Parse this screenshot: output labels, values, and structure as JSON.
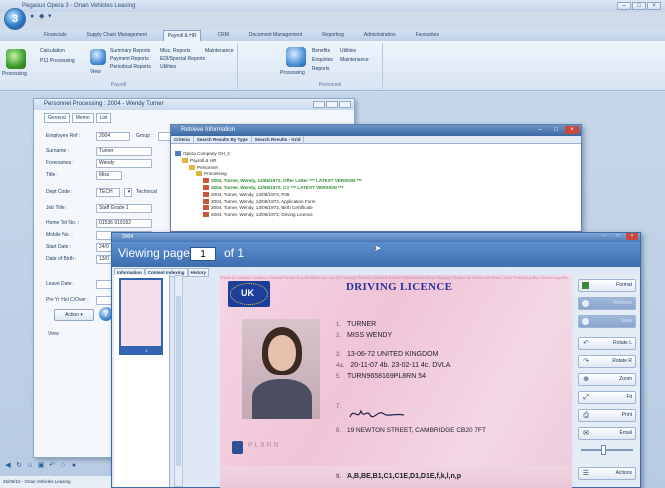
{
  "app": {
    "title": "Pegasus Opera 3 - Onan Vehicles Leasing",
    "window_controls": [
      "–",
      "□",
      "×"
    ]
  },
  "ribbon": {
    "tabs": [
      "Financials",
      "Supply Chain Management",
      "Payroll & HR",
      "CRM",
      "Document Management",
      "Reporting",
      "Administration",
      "Favourites"
    ],
    "active_tab": "Payroll & HR",
    "group_payroll": {
      "label": "Payroll",
      "processing": "Processing",
      "calculation": "Calculation",
      "p11_processing": "P11 Processing",
      "view": "View",
      "summary_reports": "Summary Reports",
      "payment_reports": "Payment Reports",
      "periodical_reports": "Periodical Reports",
      "misc_reports": "Misc. Reports",
      "edi_special_reports": "EDI/Special Reports",
      "utilities": "Utilities",
      "maintenance": "Maintenance"
    },
    "group_personnel": {
      "label": "Personnel",
      "processing": "Processing",
      "benefits": "Benefits",
      "enquiries": "Enquiries",
      "reports": "Reports",
      "utilities": "Utilities",
      "maintenance": "Maintenance"
    }
  },
  "personnel": {
    "title": "Personnel Processing : 2004 - Wendy Turner",
    "tabs": [
      "General",
      "Memo",
      "List"
    ],
    "fields": [
      {
        "label": "Employee Ref :",
        "value": "2004"
      },
      {
        "label": "Surname :",
        "value": "Turner"
      },
      {
        "label": "Forenames :",
        "value": "Wendy"
      },
      {
        "label": "Title :",
        "value": "Miss"
      },
      {
        "label": "Dept Code :",
        "value": "TECH"
      },
      {
        "label": "Job Title :",
        "value": "Staff Grade 1"
      },
      {
        "label": "Home Tel No. :",
        "value": "01536 919192"
      },
      {
        "label": "Mobile No. :",
        "value": ""
      },
      {
        "label": "Start Date :",
        "value": "24/0"
      },
      {
        "label": "Date of Birth :",
        "value": "13/0"
      },
      {
        "label": "Leave Date :",
        "value": ""
      },
      {
        "label": "Prv Yr Hol C/Over :",
        "value": ""
      }
    ],
    "group_label": "Group :",
    "dept_desc": "Technical",
    "action_btn": "Action",
    "help": "?",
    "view_label": "View"
  },
  "retrieve": {
    "title": "Retrieve Information",
    "tabs": [
      "Criteria",
      "Search Results By Type",
      "Search Results - Grid"
    ],
    "tree": [
      {
        "label": "Opera Company OH_2",
        "level": 0,
        "hl": false
      },
      {
        "label": "Payroll & HR",
        "level": 1,
        "hl": false
      },
      {
        "label": "Personnel",
        "level": 2,
        "hl": false
      },
      {
        "label": "Processing",
        "level": 3,
        "hl": false
      },
      {
        "label": "2004, Turner, Wendy, 13/06/1972, Offer Letter *** LATEST VERSION ***",
        "level": 4,
        "hl": true
      },
      {
        "label": "2004, Turner, Wendy, 13/06/1972, CV *** LATEST VERSION ***",
        "level": 4,
        "hl": true
      },
      {
        "label": "2004, Turner, Wendy, 13/06/1972, P45",
        "level": 4,
        "hl": false
      },
      {
        "label": "2004, Turner, Wendy, 13/06/1972, Application Form",
        "level": 4,
        "hl": false
      },
      {
        "label": "2004, Turner, Wendy, 13/06/1972, Birth Certificate",
        "level": 4,
        "hl": false
      },
      {
        "label": "2004, Turner, Wendy, 13/06/1972, Driving Licence",
        "level": 4,
        "hl": false
      }
    ]
  },
  "viewer": {
    "title": "2004",
    "viewing": "Viewing page",
    "page": "1",
    "of": "of 1",
    "subtabs": [
      "Information",
      "Content Indexing",
      "History"
    ],
    "thumb_page": "1",
    "buttons": [
      "Format",
      "Remove",
      "Save",
      "Rotate L",
      "Rotate R",
      "Zoom",
      "Fit",
      "Print",
      "Email",
      "Actions"
    ]
  },
  "licence": {
    "country": "UK",
    "title": "DRIVING LICENCE",
    "bg_text": "Permis de conduire Ceadúnas Tiomána Patente di guida Rijbewijs Carta de Condução Kørekort Ajokortti Körkort Führerschein Άδεια Οδήγησης Permiso de Conducción Prawo Jazdy Vodičský průkaz Vezetői engedély",
    "lines": [
      {
        "num": "1.",
        "text": "TURNER"
      },
      {
        "num": "2.",
        "text": "MISS WENDY"
      },
      {
        "num": "3.",
        "text": "13-06-72 UNITED KINGDOM"
      },
      {
        "num": "4a.",
        "text": "20-11-07  4b. 23-02-11  4c. DVLA"
      },
      {
        "num": "5.",
        "text": "TURN9658169PL8RN  54"
      },
      {
        "num": "7.",
        "text": ""
      },
      {
        "num": "8.",
        "text": "19 NEWTON STREET, CAMBRIDGE CB20 7FT"
      },
      {
        "num": "9.",
        "text": "A,B,BE,B1,C1,C1E,D1,D1E,f,k,l,n,p"
      }
    ],
    "ghost": "PL8RN"
  },
  "status": {
    "text": "25/09/10 - Onan Vehicles Leasing"
  },
  "colors": {
    "ribbon_bg": "#e6eef8",
    "title_blue": "#3a68a3",
    "licence_pink": "#f2cfdf",
    "highlight_green": "#2e8b2e"
  }
}
